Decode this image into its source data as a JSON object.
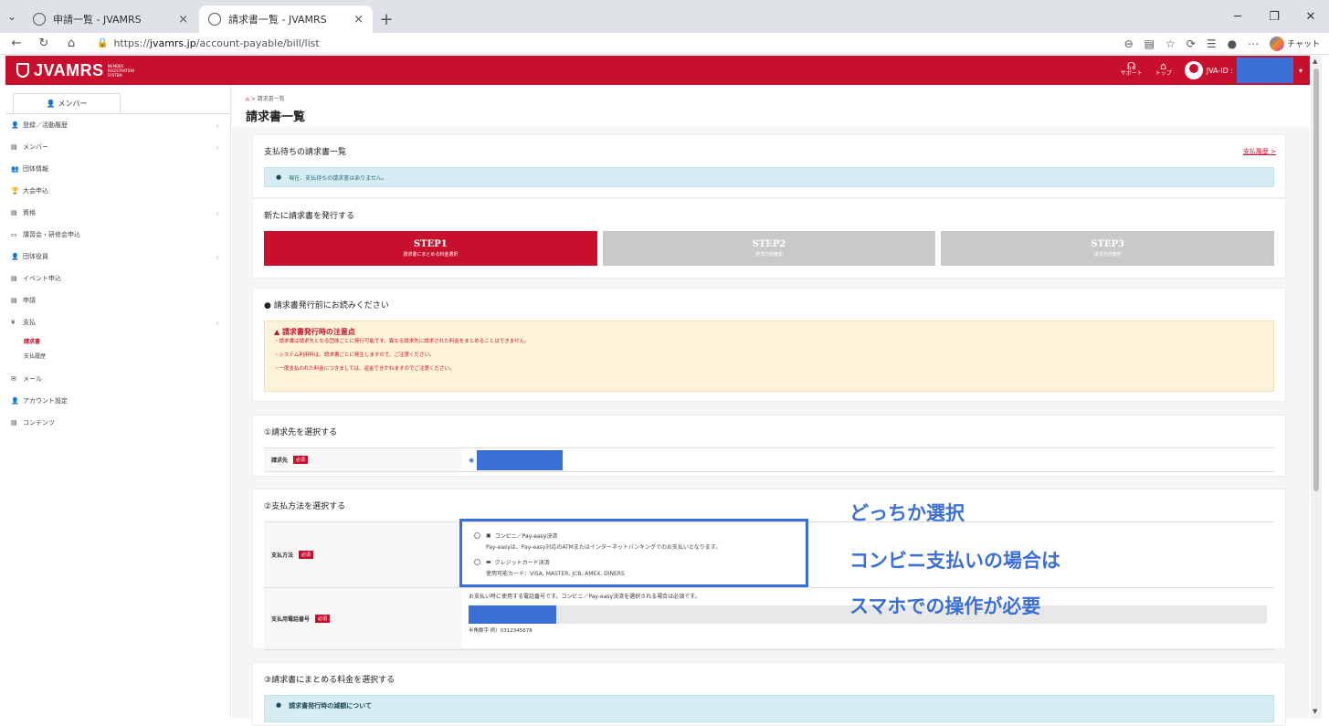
{
  "browser": {
    "tabs": [
      {
        "title": "申請一覧 - JVAMRS",
        "close": "×"
      },
      {
        "title": "請求書一覧 - JVAMRS",
        "close": "×"
      }
    ],
    "new_tab": "+",
    "url_prefix": "https://",
    "url_domain": "jvamrs.jp",
    "url_path": "/account-payable/bill/list",
    "chat_label": "チャット"
  },
  "header": {
    "logo_text": "JVAMRS",
    "logo_sub": "MEMBER REGISTRATION SYSTEM",
    "support_label": "サポート",
    "top_label": "トップ",
    "jva_id_label": "JVA-ID :"
  },
  "sidebar": {
    "tab_label": "メンバー",
    "items": [
      {
        "label": "登録／活動履歴",
        "chevron": true
      },
      {
        "label": "メンバー",
        "chevron": true
      },
      {
        "label": "団体情報",
        "chevron": false
      },
      {
        "label": "大会申込",
        "chevron": false
      },
      {
        "label": "資格",
        "chevron": true
      },
      {
        "label": "講習会・研修会申込",
        "chevron": false
      },
      {
        "label": "団体役員",
        "chevron": true
      },
      {
        "label": "イベント申込",
        "chevron": false
      },
      {
        "label": "申請",
        "chevron": false
      },
      {
        "label": "支払",
        "chevron": true
      }
    ],
    "subitems": [
      "請求書",
      "支払履歴"
    ],
    "items_after": [
      "メール",
      "アカウント設定",
      "コンテンツ"
    ]
  },
  "page": {
    "breadcrumb": "請求書一覧",
    "title": "請求書一覧"
  },
  "pending": {
    "title": "支払待ちの請求書一覧",
    "history_link": "支払履歴",
    "info": "現在、支払待ちの請求書はありません。"
  },
  "issue": {
    "title": "新たに請求書を発行する",
    "steps": [
      {
        "name": "STEP1",
        "desc": "請求書にまとめる料金選択"
      },
      {
        "name": "STEP2",
        "desc": "請求内容確認"
      },
      {
        "name": "STEP3",
        "desc": "請求内容確定"
      }
    ]
  },
  "notice": {
    "title": "請求書発行前にお読みください",
    "warn_title": "請求書発行時の注意点",
    "lines": [
      "・請求書は請求先となる団体ごとに発行可能です。異なる請求先に請求された料金をまとめることはできません。",
      "・システム利用料は、請求書ごとに発生しますので、ご注意ください。",
      "・一度支払われた料金につきましては、返金できかねますのでご注意ください。"
    ]
  },
  "billto": {
    "title": "①請求先を選択する",
    "label": "請求先",
    "required": "必須"
  },
  "payment": {
    "title": "②支払方法を選択する",
    "label": "支払方法",
    "required": "必須",
    "options": [
      {
        "name": "コンビニ／Pay-easy決済",
        "desc": "Pay-easyは、Pay-easy対応のATMまたはインターネットバンキングでのお支払いとなります。"
      },
      {
        "name": "クレジットカード決済",
        "desc": "使用可能カード：VISA, MASTER, JCB, AMEX, DINERS"
      }
    ],
    "phone_label": "支払用電話番号",
    "phone_note": "お支払い時に使用する電話番号です。コンビニ／Pay-easy決済を選択される場合は必須です。",
    "phone_hint": "半角数字 例）0312345678"
  },
  "fees": {
    "title": "③請求書にまとめる料金を選択する",
    "info_title": "請求書発行時の減額について"
  },
  "annotation": {
    "line1": "どっちか選択",
    "line2": "コンビニ支払いの場合は",
    "line3": "スマホでの操作が必要"
  },
  "colors": {
    "brand": "#c8102e",
    "annotation": "#3b6fd8"
  }
}
